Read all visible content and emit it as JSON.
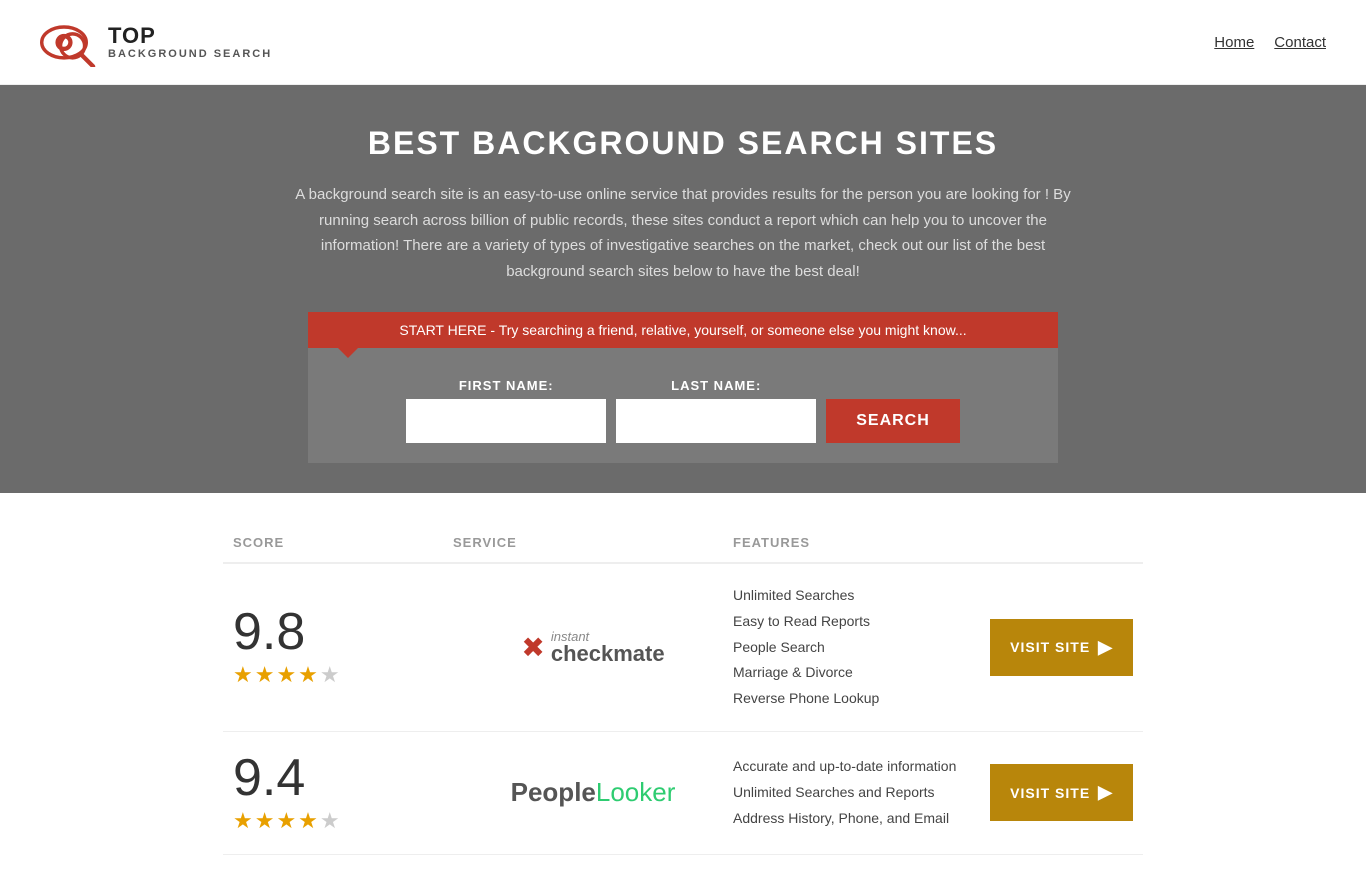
{
  "header": {
    "logo": {
      "top": "TOP",
      "bottom": "BACKGROUND SEARCH",
      "icon_label": "magnifying-glass-eye-icon"
    },
    "nav": [
      {
        "label": "Home",
        "href": "#"
      },
      {
        "label": "Contact",
        "href": "#"
      }
    ]
  },
  "hero": {
    "title": "BEST BACKGROUND SEARCH SITES",
    "description": "A background search site is an easy-to-use online service that provides results  for the person you are looking for ! By  running  search across billion of public records, these sites conduct  a report which can help you to uncover the information! There are a variety of types of investigative searches on the market, check out our  list of the best background search sites below to have the best deal!",
    "search_banner": "START HERE - Try searching a friend, relative, yourself, or someone else you might know...",
    "form": {
      "first_name_label": "FIRST NAME:",
      "last_name_label": "LAST NAME:",
      "first_name_placeholder": "",
      "last_name_placeholder": "",
      "search_button": "SEARCH"
    }
  },
  "table": {
    "headers": {
      "score": "SCORE",
      "service": "SERVICE",
      "features": "FEATURES",
      "action": ""
    },
    "rows": [
      {
        "score": "9.8",
        "stars": "★★★★★",
        "star_count": 5,
        "service_name": "Instant Checkmate",
        "service_logo_type": "checkmate",
        "features": [
          "Unlimited Searches",
          "Easy to Read Reports",
          "People Search",
          "Marriage & Divorce",
          "Reverse Phone Lookup"
        ],
        "visit_label": "VISIT SITE",
        "visit_href": "#"
      },
      {
        "score": "9.4",
        "stars": "★★★★★",
        "star_count": 5,
        "service_name": "PeopleLooker",
        "service_logo_type": "peoplelooker",
        "features": [
          "Accurate and up-to-date information",
          "Unlimited Searches and Reports",
          "Address History, Phone, and Email"
        ],
        "visit_label": "VISIT SITE",
        "visit_href": "#"
      }
    ]
  },
  "colors": {
    "accent_red": "#c0392b",
    "star_gold": "#e8a000",
    "visit_gold": "#b8860b",
    "hero_bg": "#6b6b6b"
  }
}
